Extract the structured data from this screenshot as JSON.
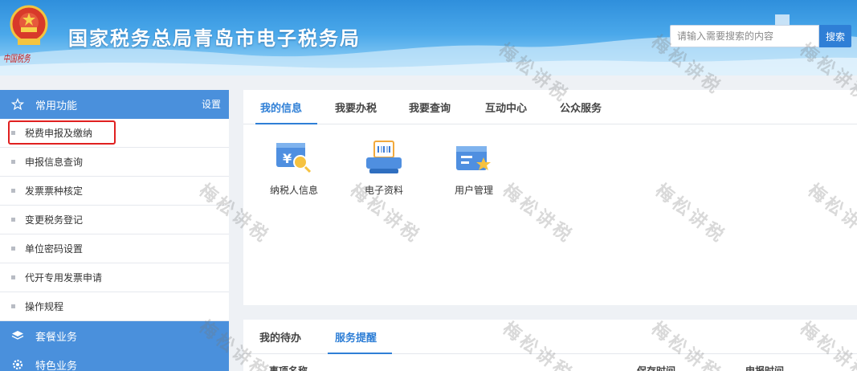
{
  "header": {
    "title": "国家税务总局青岛市电子税务局",
    "emblem_caption": "中国税务",
    "search": {
      "placeholder": "请输入需要搜索的内容",
      "button_label": "搜索"
    }
  },
  "sidebar": {
    "section_common": {
      "label": "常用功能",
      "icon": "star-icon",
      "settings_label": "设置"
    },
    "items": [
      {
        "label": "税费申报及缴纳",
        "highlighted": true
      },
      {
        "label": "申报信息查询"
      },
      {
        "label": "发票票种核定"
      },
      {
        "label": "变更税务登记"
      },
      {
        "label": "单位密码设置"
      },
      {
        "label": "代开专用发票申请"
      },
      {
        "label": "操作规程"
      }
    ],
    "section_package": {
      "label": "套餐业务",
      "icon": "layers-icon"
    },
    "section_special": {
      "label": "特色业务",
      "icon": "gear-icon"
    }
  },
  "main": {
    "tabs": [
      {
        "label": "我的信息",
        "active": true
      },
      {
        "label": "我要办税"
      },
      {
        "label": "我要查询"
      },
      {
        "label": "互动中心"
      },
      {
        "label": "公众服务"
      }
    ],
    "tiles": [
      {
        "label": "纳税人信息",
        "icon": "taxpayer-info-icon"
      },
      {
        "label": "电子资料",
        "icon": "electronic-docs-icon"
      },
      {
        "label": "用户管理",
        "icon": "user-management-icon"
      }
    ]
  },
  "bottom": {
    "tabs": [
      {
        "label": "我的待办"
      },
      {
        "label": "服务提醒",
        "active": true
      }
    ],
    "columns": [
      "事项名称",
      "保存时间",
      "申报时间"
    ]
  },
  "watermark": {
    "text": "梅松讲税"
  },
  "colors": {
    "accent": "#2f7fd6",
    "sidebar_header": "#4a90dc",
    "highlight_border": "#e02020"
  }
}
